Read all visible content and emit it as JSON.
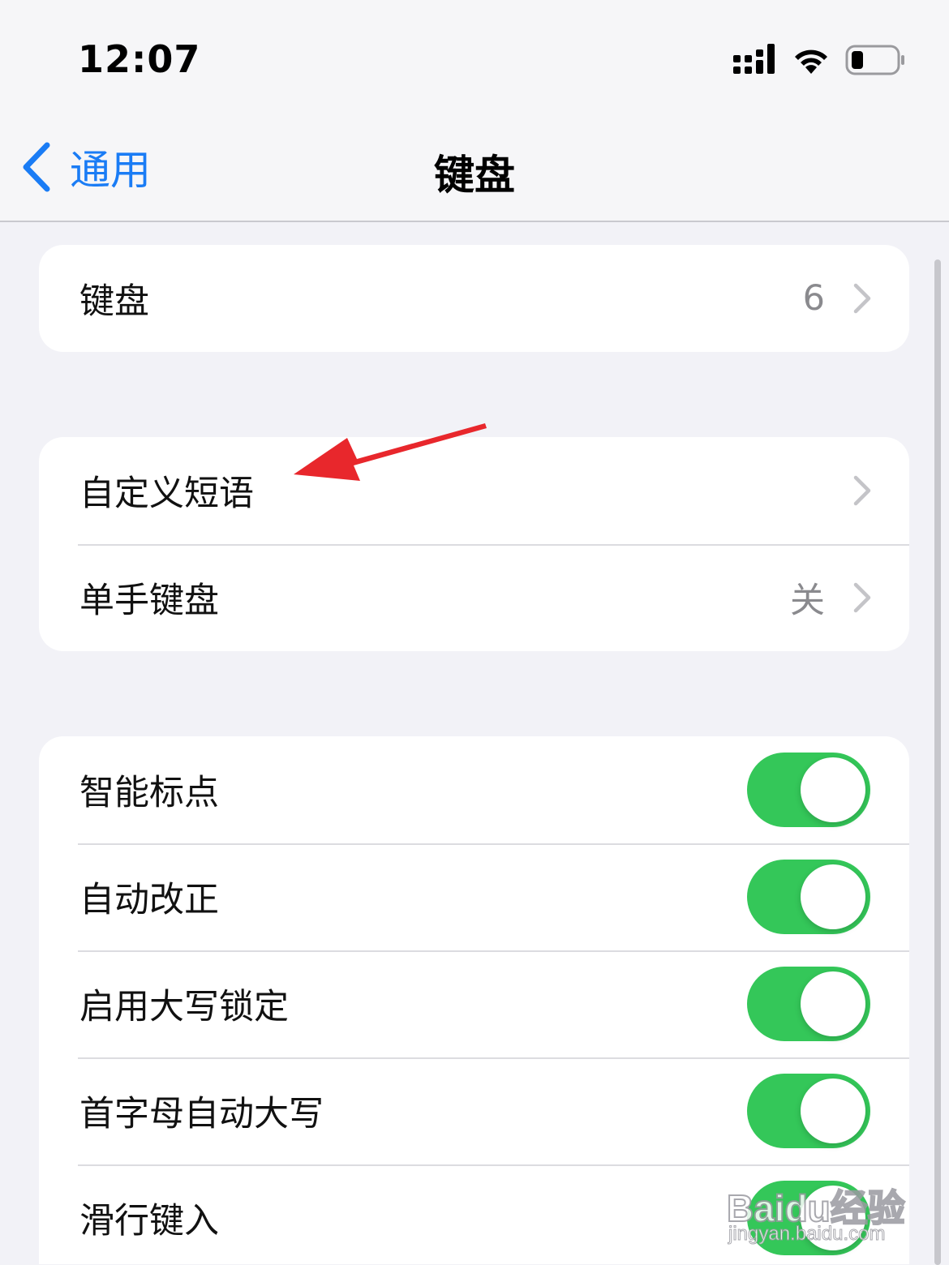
{
  "status_bar": {
    "time": "12:07",
    "icons": [
      "signal-icon",
      "wifi-icon",
      "battery-icon"
    ]
  },
  "nav": {
    "back_label": "通用",
    "title": "键盘"
  },
  "groups": [
    {
      "rows": [
        {
          "label": "键盘",
          "value": "6",
          "accessory": "chevron"
        }
      ]
    },
    {
      "rows": [
        {
          "label": "自定义短语",
          "value": "",
          "accessory": "chevron"
        },
        {
          "label": "单手键盘",
          "value": "关",
          "accessory": "chevron"
        }
      ]
    },
    {
      "rows": [
        {
          "label": "智能标点",
          "toggle": true
        },
        {
          "label": "自动改正",
          "toggle": true
        },
        {
          "label": "启用大写锁定",
          "toggle": true
        },
        {
          "label": "首字母自动大写",
          "toggle": true
        },
        {
          "label": "滑行键入",
          "toggle": true
        }
      ]
    }
  ],
  "colors": {
    "accent": "#1a7cf5",
    "toggle_on": "#34c759",
    "background": "#f2f2f7",
    "annotation": "#e8272c"
  },
  "watermark": {
    "brand": "Baidu经验",
    "url": "jingyan.baidu.com"
  }
}
